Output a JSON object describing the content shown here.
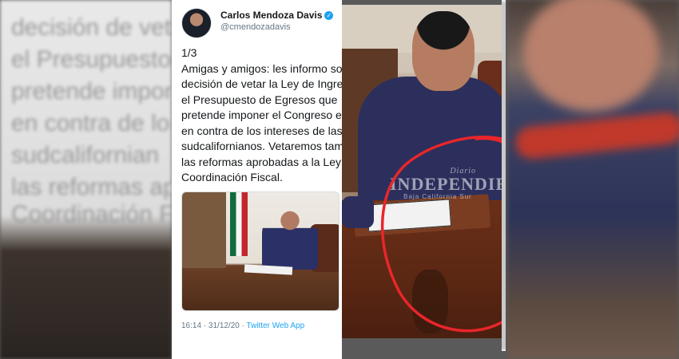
{
  "tweet": {
    "author_name": "Carlos Mendoza Davis",
    "handle": "@cmendozadavis",
    "text_lines": [
      "1/3",
      "Amigas y amigos: les informo sobre",
      "decisión de vetar la Ley de Ingreso",
      "el Presupuesto de Egresos que",
      "pretende imponer el Congreso esta",
      "en contra de los intereses de las y",
      "sudcalifornianos. Vetaremos tambi",
      "las reformas aprobadas a la Ley de",
      "Coordinación Fiscal."
    ],
    "timestamp": "16:14 · 31/12/20 · ",
    "source": "Twitter Web App"
  },
  "watermark": {
    "small": "Diario",
    "big": "INDEPENDIENTE",
    "sub": "Baja California Sur"
  },
  "background_ghost_text": [
    "decisión de vet",
    "el Presupuesto",
    "pretende impon",
    "en contra de lo",
    "sudcalifornian",
    "las reformas ap",
    "Coordinación F"
  ],
  "colors": {
    "link": "#1da1f2",
    "annotation_circle": "#e8262a"
  }
}
